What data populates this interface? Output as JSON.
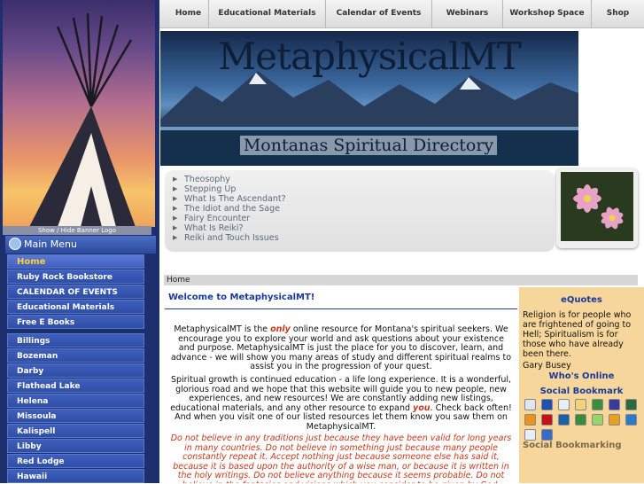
{
  "banner": {
    "toggle_label": "Show / Hide Banner Logo"
  },
  "sidebar": {
    "heading": "Main Menu",
    "items": [
      {
        "label": "Home",
        "active": true
      },
      {
        "label": "Ruby Rock Bookstore"
      },
      {
        "label": "CALENDAR OF EVENTS"
      },
      {
        "label": "Educational Materials"
      },
      {
        "label": "Free E Books"
      },
      {
        "label": "Billings"
      },
      {
        "label": "Bozeman"
      },
      {
        "label": "Darby"
      },
      {
        "label": "Flathead Lake"
      },
      {
        "label": "Helena"
      },
      {
        "label": "Missoula"
      },
      {
        "label": "Kalispell"
      },
      {
        "label": "Libby"
      },
      {
        "label": "Red Lodge"
      },
      {
        "label": "Hawaii"
      }
    ]
  },
  "topnav": {
    "items": [
      {
        "label": "Home"
      },
      {
        "label": "Educational Materials"
      },
      {
        "label": "Calendar of Events"
      },
      {
        "label": "Webinars"
      },
      {
        "label": "Workshop Space"
      },
      {
        "label": "Shop"
      }
    ]
  },
  "header": {
    "title": "MetaphysicalMT",
    "subtitle": "Montanas Spiritual Directory"
  },
  "news": {
    "items": [
      {
        "label": "Theosophy"
      },
      {
        "label": "Stepping Up"
      },
      {
        "label": "What Is The Ascendant?"
      },
      {
        "label": "The Idiot and the Sage"
      },
      {
        "label": "Fairy Encounter"
      },
      {
        "label": "What Is Reiki?"
      },
      {
        "label": "Reiki and Touch Issues"
      }
    ]
  },
  "breadcrumb": {
    "label": "Home"
  },
  "content": {
    "welcome": "Welcome to MetaphysicalMT!",
    "p1_a": "MetaphysicalMT is the ",
    "p1_em": "only",
    "p1_b": " online resource for Montana's spiritual seekers. We encourage you to explore your world and ask questions about your existence and purpose. MetaphysicalMT is just the place for you to discover, learn, and advance - we will show you many areas of study and different spiritual realms to assist you in the progression of your quest.",
    "p2_a": "Spiritual growth is continued education - a life long experience. It is a wonderful, glorious road and we hope that this website will guide you to new people, new experiences, and new resources! We are constantly adding new listings, educational materials, and any other resource to expand ",
    "p2_em": "you",
    "p2_b": ". Check back often! And when you visit one of our listed resources let them know you saw them on MetaphysicalMT.",
    "quote": "Do not believe in any traditions just because they have been valid for long years in many countries. Do not believe in something just because many people constantly repeat it. Accept nothing just because someone else has said it, because it is based upon the authority of a wise man, or because it is written in the holy writings. Do not believe anything because it seems probable. Do not believe in the fantasies and visions which you consider to be given by God. Believe nothing just because the"
  },
  "right": {
    "equotes_title": "eQuotes",
    "quote": "Religion is for people who are frightened of going to Hell; Spiritualism is for those who have already been there.",
    "author": "Gary Busey",
    "whos_online": "Who's Online",
    "social_title": "Social Bookmark",
    "social_footer": "Social Bookmarking",
    "social_icons": [
      {
        "icon": "digg-icon",
        "color": "#dfe6f0"
      },
      {
        "icon": "delicious-icon",
        "color": "#1f4fb0"
      },
      {
        "icon": "reddit-icon",
        "color": "#e8eef6"
      },
      {
        "icon": "furl-icon",
        "color": "#f2d27a"
      },
      {
        "icon": "stumbleupon-icon",
        "color": "#3b8e3b"
      },
      {
        "icon": "blinklist-icon",
        "color": "#3a3a9a"
      },
      {
        "icon": "spurl-icon",
        "color": "#2e6a3e"
      },
      {
        "icon": "mixx-icon",
        "color": "#e8931e"
      },
      {
        "icon": "yahoo-icon",
        "color": "#c5121a"
      },
      {
        "icon": "newsvine-icon",
        "color": "#1f5fa8"
      },
      {
        "icon": "technorati-icon",
        "color": "#3c8a3c"
      },
      {
        "icon": "google-icon",
        "color": "#9bd36a"
      },
      {
        "icon": "blogmarks-icon",
        "color": "#e8a020"
      },
      {
        "icon": "magnolia-icon",
        "color": "#2a7ac8"
      },
      {
        "icon": "ma-gnolia-icon",
        "color": "#e8eef6"
      },
      {
        "icon": "help-icon",
        "color": "#3a6ac8"
      }
    ]
  }
}
